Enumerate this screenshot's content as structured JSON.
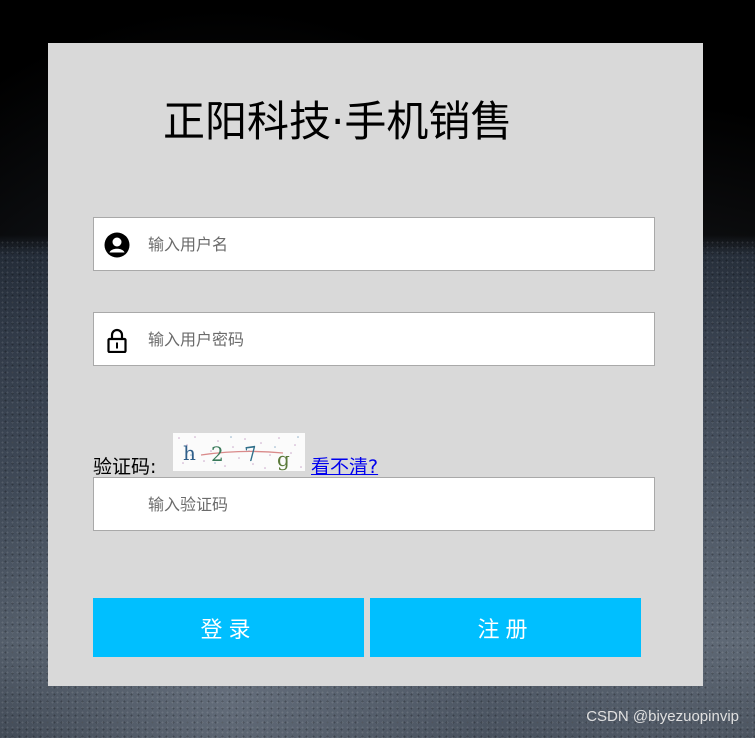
{
  "header": {
    "title": "正阳科技·手机销售"
  },
  "form": {
    "username": {
      "placeholder": "输入用户名",
      "icon": "user-icon"
    },
    "password": {
      "placeholder": "输入用户密码",
      "icon": "lock-icon"
    },
    "captcha": {
      "label": "验证码:",
      "image_text": "h 2 7 g",
      "refresh_link": "看不清?",
      "input_placeholder": "输入验证码"
    }
  },
  "buttons": {
    "login": "登录",
    "register": "注册"
  },
  "colors": {
    "accent": "#00bfff",
    "panel_bg": "#d9d9d9",
    "link": "#0000ee"
  },
  "watermark": "CSDN @biyezuopinvip"
}
